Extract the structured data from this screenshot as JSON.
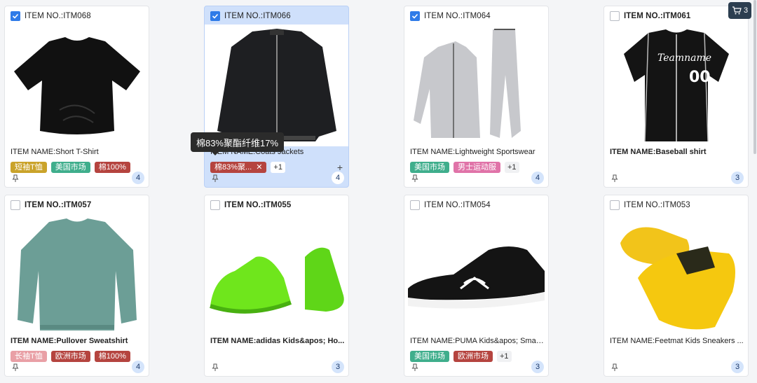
{
  "cart": {
    "count": "3"
  },
  "tooltip": {
    "text": "棉83%聚酯纤维17%"
  },
  "colors": {
    "tag_gold": "#caa32a",
    "tag_green": "#3fae8c",
    "tag_red": "#b5443f",
    "tag_pink": "#e073a8",
    "tag_lightpink": "#e9a0a6",
    "checkbox": "#2f7be8",
    "selected_bg": "#cfe0fb"
  },
  "cards": [
    {
      "item_no": "ITEM NO.:ITM068",
      "name": "ITEM NAME:Short T-Shirt",
      "checked": true,
      "tags": [
        "短袖T恤",
        "美国市场",
        "棉100%"
      ],
      "more": "",
      "count": "4",
      "image": "tshirt-image"
    },
    {
      "item_no": "ITEM NO.:ITM066",
      "name": "ITEM NAME:Coats Jackets",
      "checked": true,
      "tags": [
        "棉83%聚..."
      ],
      "more": "+1",
      "count": "4",
      "image": "jacket-image"
    },
    {
      "item_no": "ITEM NO.:ITM064",
      "name": "ITEM NAME:Lightweight Sportswear",
      "checked": true,
      "tags": [
        "美国市场",
        "男士运动服"
      ],
      "more": "+1",
      "count": "4",
      "image": "sportswear-image"
    },
    {
      "item_no": "ITEM NO.:ITM061",
      "name": "ITEM NAME:Baseball shirt",
      "checked": false,
      "tags": [],
      "more": "",
      "count": "3",
      "image": "baseball-shirt-image"
    },
    {
      "item_no": "ITEM NO.:ITM057",
      "name": "ITEM NAME:Pullover Sweatshirt",
      "checked": false,
      "tags": [
        "长袖T恤",
        "欧洲市场",
        "棉100%"
      ],
      "more": "",
      "count": "4",
      "image": "sweatshirt-image"
    },
    {
      "item_no": "ITEM NO.:ITM055",
      "name": "ITEM NAME:adidas Kids&apos; Ho...",
      "checked": false,
      "tags": [],
      "more": "",
      "count": "3",
      "image": "green-sneakers-image"
    },
    {
      "item_no": "ITEM NO.:ITM054",
      "name": "ITEM NAME:PUMA Kids&apos; Smas...",
      "checked": false,
      "tags": [
        "美国市场",
        "欧洲市场"
      ],
      "more": "+1",
      "count": "3",
      "image": "black-sneaker-image"
    },
    {
      "item_no": "ITEM NO.:ITM053",
      "name": "ITEM NAME:Feetmat Kids Sneakers ...",
      "checked": false,
      "tags": [],
      "more": "",
      "count": "3",
      "image": "yellow-sneakers-image"
    }
  ],
  "tagColors": {
    "短袖T恤": "tag_gold",
    "美国市场": "tag_green",
    "棉100%": "tag_red",
    "棉83%聚...": "tag_red",
    "男士运动服": "tag_pink",
    "长袖T恤": "tag_lightpink",
    "欧洲市场": "tag_red"
  }
}
